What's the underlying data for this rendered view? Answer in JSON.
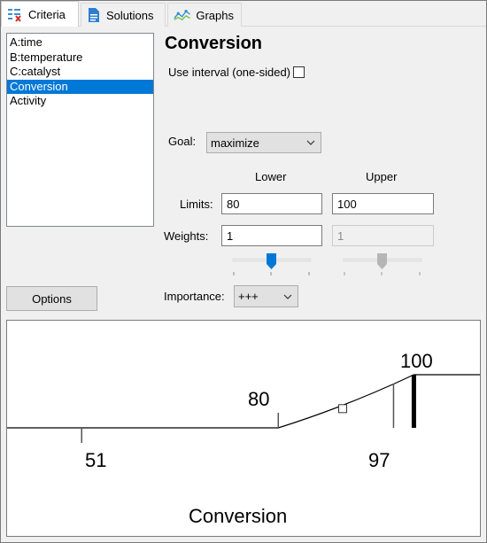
{
  "tabs": [
    {
      "label": "Criteria",
      "icon": "criteria-icon",
      "active": true
    },
    {
      "label": "Solutions",
      "icon": "document-icon",
      "active": false
    },
    {
      "label": "Graphs",
      "icon": "graph-icon",
      "active": false
    }
  ],
  "factors": [
    "A:time",
    "B:temperature",
    "C:catalyst",
    "Conversion",
    "Activity"
  ],
  "selected_factor": "Conversion",
  "criteria": {
    "title": "Conversion",
    "use_interval_label": "Use interval (one-sided)",
    "use_interval_checked": false,
    "goal_label": "Goal:",
    "goal_value": "maximize",
    "lower_header": "Lower",
    "upper_header": "Upper",
    "limits_label": "Limits:",
    "lower_limit": "80",
    "upper_limit": "100",
    "weights_label": "Weights:",
    "lower_weight": "1",
    "upper_weight": "1",
    "importance_label": "Importance:",
    "importance_value": "+++",
    "options_label": "Options"
  },
  "chart_data": {
    "type": "line",
    "title": "Conversion",
    "xlim": [
      40,
      110
    ],
    "tick_labels": [
      "51",
      "80",
      "97",
      "100"
    ],
    "desirability": {
      "x": [
        40,
        80,
        100,
        110
      ],
      "y": [
        0,
        0,
        1,
        1
      ]
    },
    "min_observed": 51,
    "max_observed": 97,
    "lower_limit": 80,
    "upper_limit": 100,
    "current_point_x": 89.5
  },
  "colors": {
    "selection": "#0078d7",
    "slider_active": "#0078d7",
    "slider_inactive": "#b5b5b5"
  }
}
